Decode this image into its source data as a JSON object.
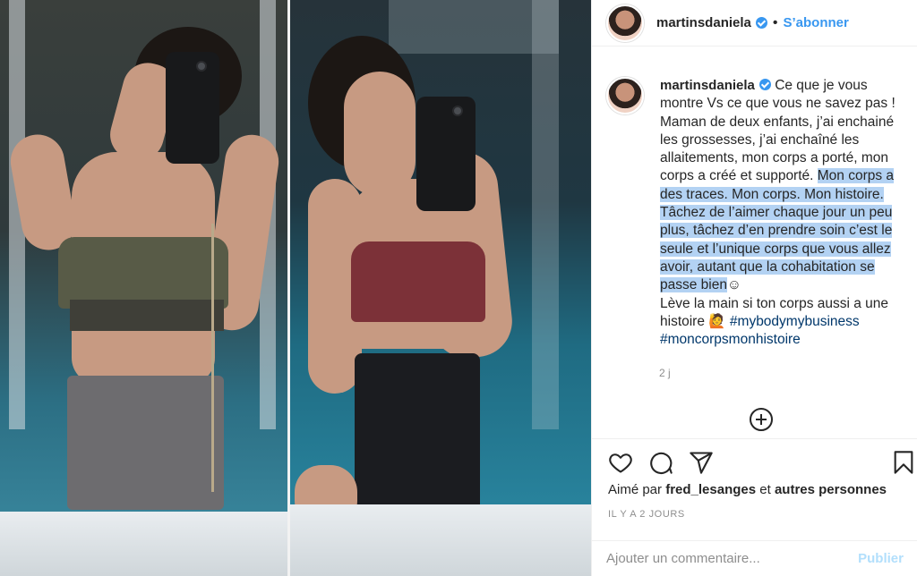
{
  "post": {
    "username": "martinsdaniela",
    "follow_label": "S’abonner",
    "separator": "•"
  },
  "caption": {
    "username": "martinsdaniela",
    "part1": "Ce que je vous montre Vs ce que vous ne savez pas ! Maman de deux enfants, j’ai enchainé les grossesses, j’ai enchaîné les allaitements, mon corps a porté, mon corps a créé et supporté. ",
    "highlighted": "Mon corps a des traces. Mon corps. Mon histoire. Tâchez de l’aimer chaque jour un peu plus, tâchez d’en prendre soin c’est le seule et l’unique corps que vous allez avoir, autant que la cohabitation se passe bien",
    "emoji_smile": "☺",
    "part2": "Lève la main si ton corps aussi a une histoire",
    "emoji_hand": "🙋",
    "hashtag1": "#mybodymybusiness",
    "hashtag2": "#moncorpsmonhistoire",
    "time": "2 j"
  },
  "likes": {
    "prefix": "Aimé par",
    "user": "fred_lesanges",
    "and": "et",
    "others": "autres personnes"
  },
  "posted_ago": "IL Y A 2 JOURS",
  "comment": {
    "placeholder": "Ajouter un commentaire...",
    "publish_label": "Publier"
  },
  "icons": [
    "heart-icon",
    "comment-icon",
    "share-icon",
    "bookmark-icon",
    "add-more-icon",
    "verified-icon"
  ],
  "colors": {
    "link": "#3897f0",
    "hashtag": "#00376b",
    "highlight": "#b3d2f3",
    "publish_disabled": "#b2dffc",
    "muted": "#8e8e8e"
  }
}
